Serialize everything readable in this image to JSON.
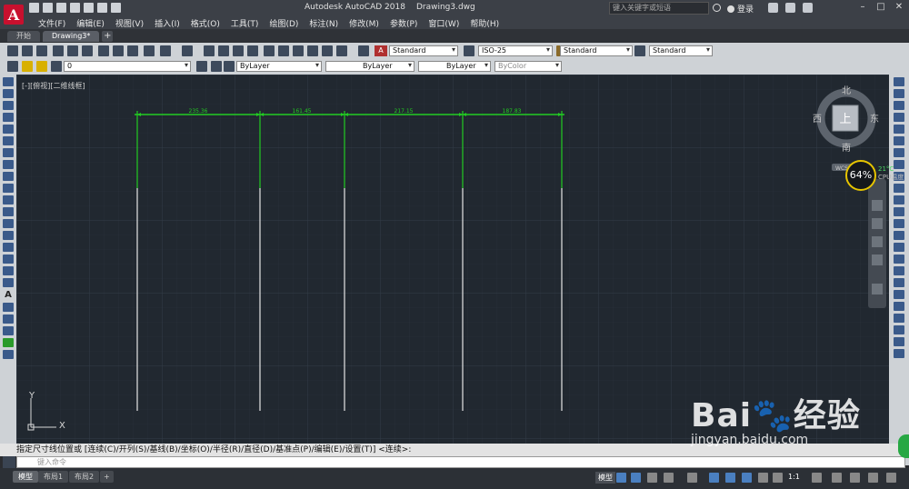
{
  "app": {
    "logo_letter": "A",
    "title": "Autodesk AutoCAD 2018",
    "filename": "Drawing3.dwg",
    "search_placeholder": "键入关键字或短语",
    "login_label": "登录"
  },
  "menu": [
    "文件(F)",
    "编辑(E)",
    "视图(V)",
    "插入(I)",
    "格式(O)",
    "工具(T)",
    "绘图(D)",
    "标注(N)",
    "修改(M)",
    "参数(P)",
    "窗口(W)",
    "帮助(H)"
  ],
  "tabs": [
    {
      "label": "开始",
      "active": false
    },
    {
      "label": "Drawing3*",
      "active": true
    }
  ],
  "toolbar": {
    "text_style": "Standard",
    "dim_style": "ISO-25",
    "table_style": "Standard",
    "mleader_style": "Standard",
    "layer": "0",
    "color": "ByLayer",
    "linetype": "ByLayer",
    "lineweight": "ByLayer",
    "plotstyle": "ByColor"
  },
  "viewport": {
    "label": "[-][俯视][二维线框]"
  },
  "drawing": {
    "dimensions": [
      "235.36",
      "161.45",
      "217.15",
      "187.83"
    ]
  },
  "viewcube": {
    "north": "北",
    "south": "南",
    "east": "东",
    "west": "西",
    "top": "上",
    "wcs": "WCS"
  },
  "ucs": {
    "x": "X",
    "y": "Y"
  },
  "cpu_widget": {
    "percent": "64%",
    "temp": "21°C",
    "label": "CPU温度"
  },
  "command": {
    "prompt": "指定尺寸线位置或 [连续(C)/开列(S)/基线(B)/坐标(O)/半径(R)/直径(D)/基准点(P)/编辑(E)/设置(T)] <连续>:",
    "input_placeholder": "键入命令"
  },
  "layouts": [
    {
      "label": "模型",
      "active": true
    },
    {
      "label": "布局1",
      "active": false
    },
    {
      "label": "布局2",
      "active": false
    }
  ],
  "status": {
    "model_label": "模型",
    "scale": "1:1"
  },
  "watermark": {
    "brand": "Bai",
    "brand_suffix": "经验",
    "url": "jingyan.baidu.com"
  },
  "colors": {
    "canvas_bg": "#212830",
    "dim_green": "#22cc22",
    "line_white": "#e6e6e6"
  }
}
